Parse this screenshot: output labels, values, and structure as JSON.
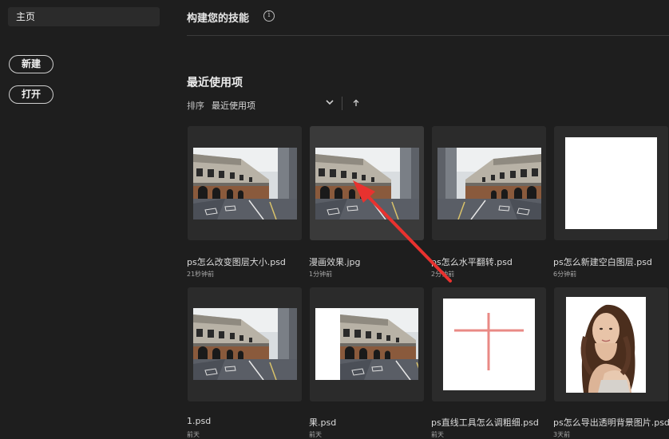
{
  "sidebar": {
    "home": "主页",
    "new_button": "新建",
    "open_button": "打开"
  },
  "skills": {
    "title": "构建您的技能",
    "info_glyph": "i"
  },
  "recent": {
    "title": "最近使用项",
    "sort_label": "排序",
    "sort_value": "最近使用项",
    "files": [
      {
        "name": "ps怎么改变图层大小.psd",
        "time": "21秒钟前",
        "thumb": "street"
      },
      {
        "name": "漫画效果.jpg",
        "time": "1分钟前",
        "thumb": "street"
      },
      {
        "name": "ps怎么水平翻转.psd",
        "time": "2分钟前",
        "thumb": "street-flipped"
      },
      {
        "name": "ps怎么新建空白图层.psd",
        "time": "6分钟前",
        "thumb": "blank"
      },
      {
        "name": "1.psd",
        "time": "前天",
        "thumb": "street"
      },
      {
        "name": "果.psd",
        "time": "前天",
        "thumb": "street-offset"
      },
      {
        "name": "ps直线工具怎么调粗细.psd",
        "time": "前天",
        "thumb": "cross"
      },
      {
        "name": "ps怎么导出透明背景图片.psd",
        "time": "3天前",
        "thumb": "portrait"
      }
    ]
  },
  "colors": {
    "background": "#1e1e1e",
    "card": "#2b2b2b",
    "card_hover": "#3a3a3a",
    "annotation_arrow": "#e8322f"
  }
}
